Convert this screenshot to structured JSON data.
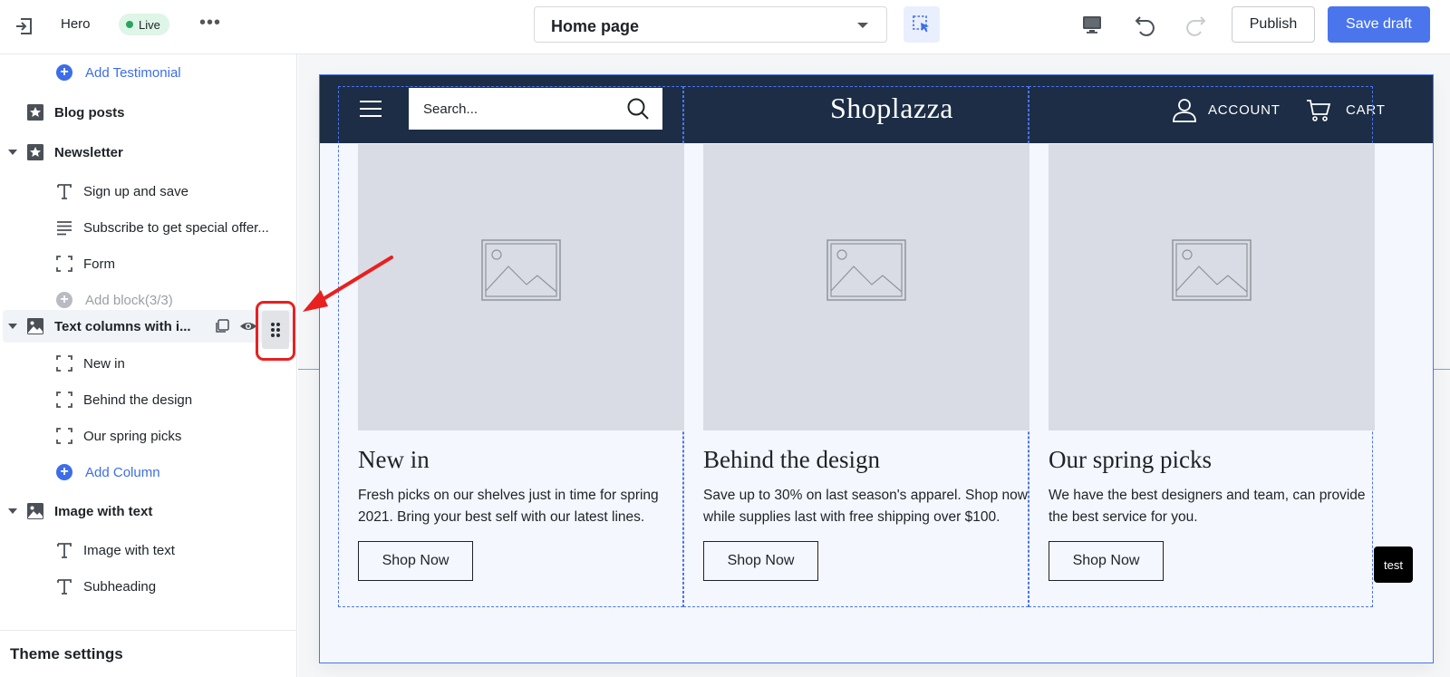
{
  "topbar": {
    "title": "Hero",
    "live_badge": "Live",
    "more": "•••",
    "page_selector": "Home page",
    "publish_label": "Publish",
    "save_label": "Save draft"
  },
  "sidebar": {
    "add_testimonial": "Add Testimonial",
    "items": [
      {
        "label": "Blog posts",
        "type": "section",
        "icon": "star-icon"
      },
      {
        "label": "Newsletter",
        "type": "section",
        "icon": "star-icon"
      },
      {
        "label": "Sign up and save",
        "type": "block",
        "icon": "text-icon"
      },
      {
        "label": "Subscribe to get special offer...",
        "type": "block",
        "icon": "paragraph-icon"
      },
      {
        "label": "Form",
        "type": "block",
        "icon": "frame-icon"
      },
      {
        "label": "Add block(3/3)",
        "type": "add-disabled",
        "icon": "plus-icon"
      },
      {
        "label": "Text columns with i...",
        "type": "section",
        "icon": "image-icon"
      },
      {
        "label": "New in",
        "type": "block",
        "icon": "frame-icon"
      },
      {
        "label": "Behind the design",
        "type": "block",
        "icon": "frame-icon"
      },
      {
        "label": "Our spring picks",
        "type": "block",
        "icon": "frame-icon"
      },
      {
        "label": "Add Column",
        "type": "add",
        "icon": "plus-icon"
      },
      {
        "label": "Image with text",
        "type": "section",
        "icon": "image-icon"
      },
      {
        "label": "Image with text",
        "type": "block",
        "icon": "text-icon"
      },
      {
        "label": "Subheading",
        "type": "block",
        "icon": "text-icon"
      }
    ],
    "theme_settings": "Theme settings"
  },
  "store": {
    "search_placeholder": "Search...",
    "logo": "Shoplazza",
    "account_label": "ACCOUNT",
    "cart_label": "CART",
    "columns": [
      {
        "title": "New in",
        "text": "Fresh picks on our shelves just in time for spring 2021. Bring your best self with our latest lines.",
        "button": "Shop Now"
      },
      {
        "title": "Behind the design",
        "text": "Save up to 30% on last season's apparel. Shop now while supplies last with free shipping over $100.",
        "button": "Shop Now"
      },
      {
        "title": "Our spring picks",
        "text": "We have the best designers and team, can provide the best service for you.",
        "button": "Shop Now"
      }
    ],
    "tooltip": "test"
  },
  "colors": {
    "accent": "#4a75ec",
    "header_bg": "#1c2d45",
    "highlight_red": "#e8201f",
    "live_green": "#28a55f"
  }
}
